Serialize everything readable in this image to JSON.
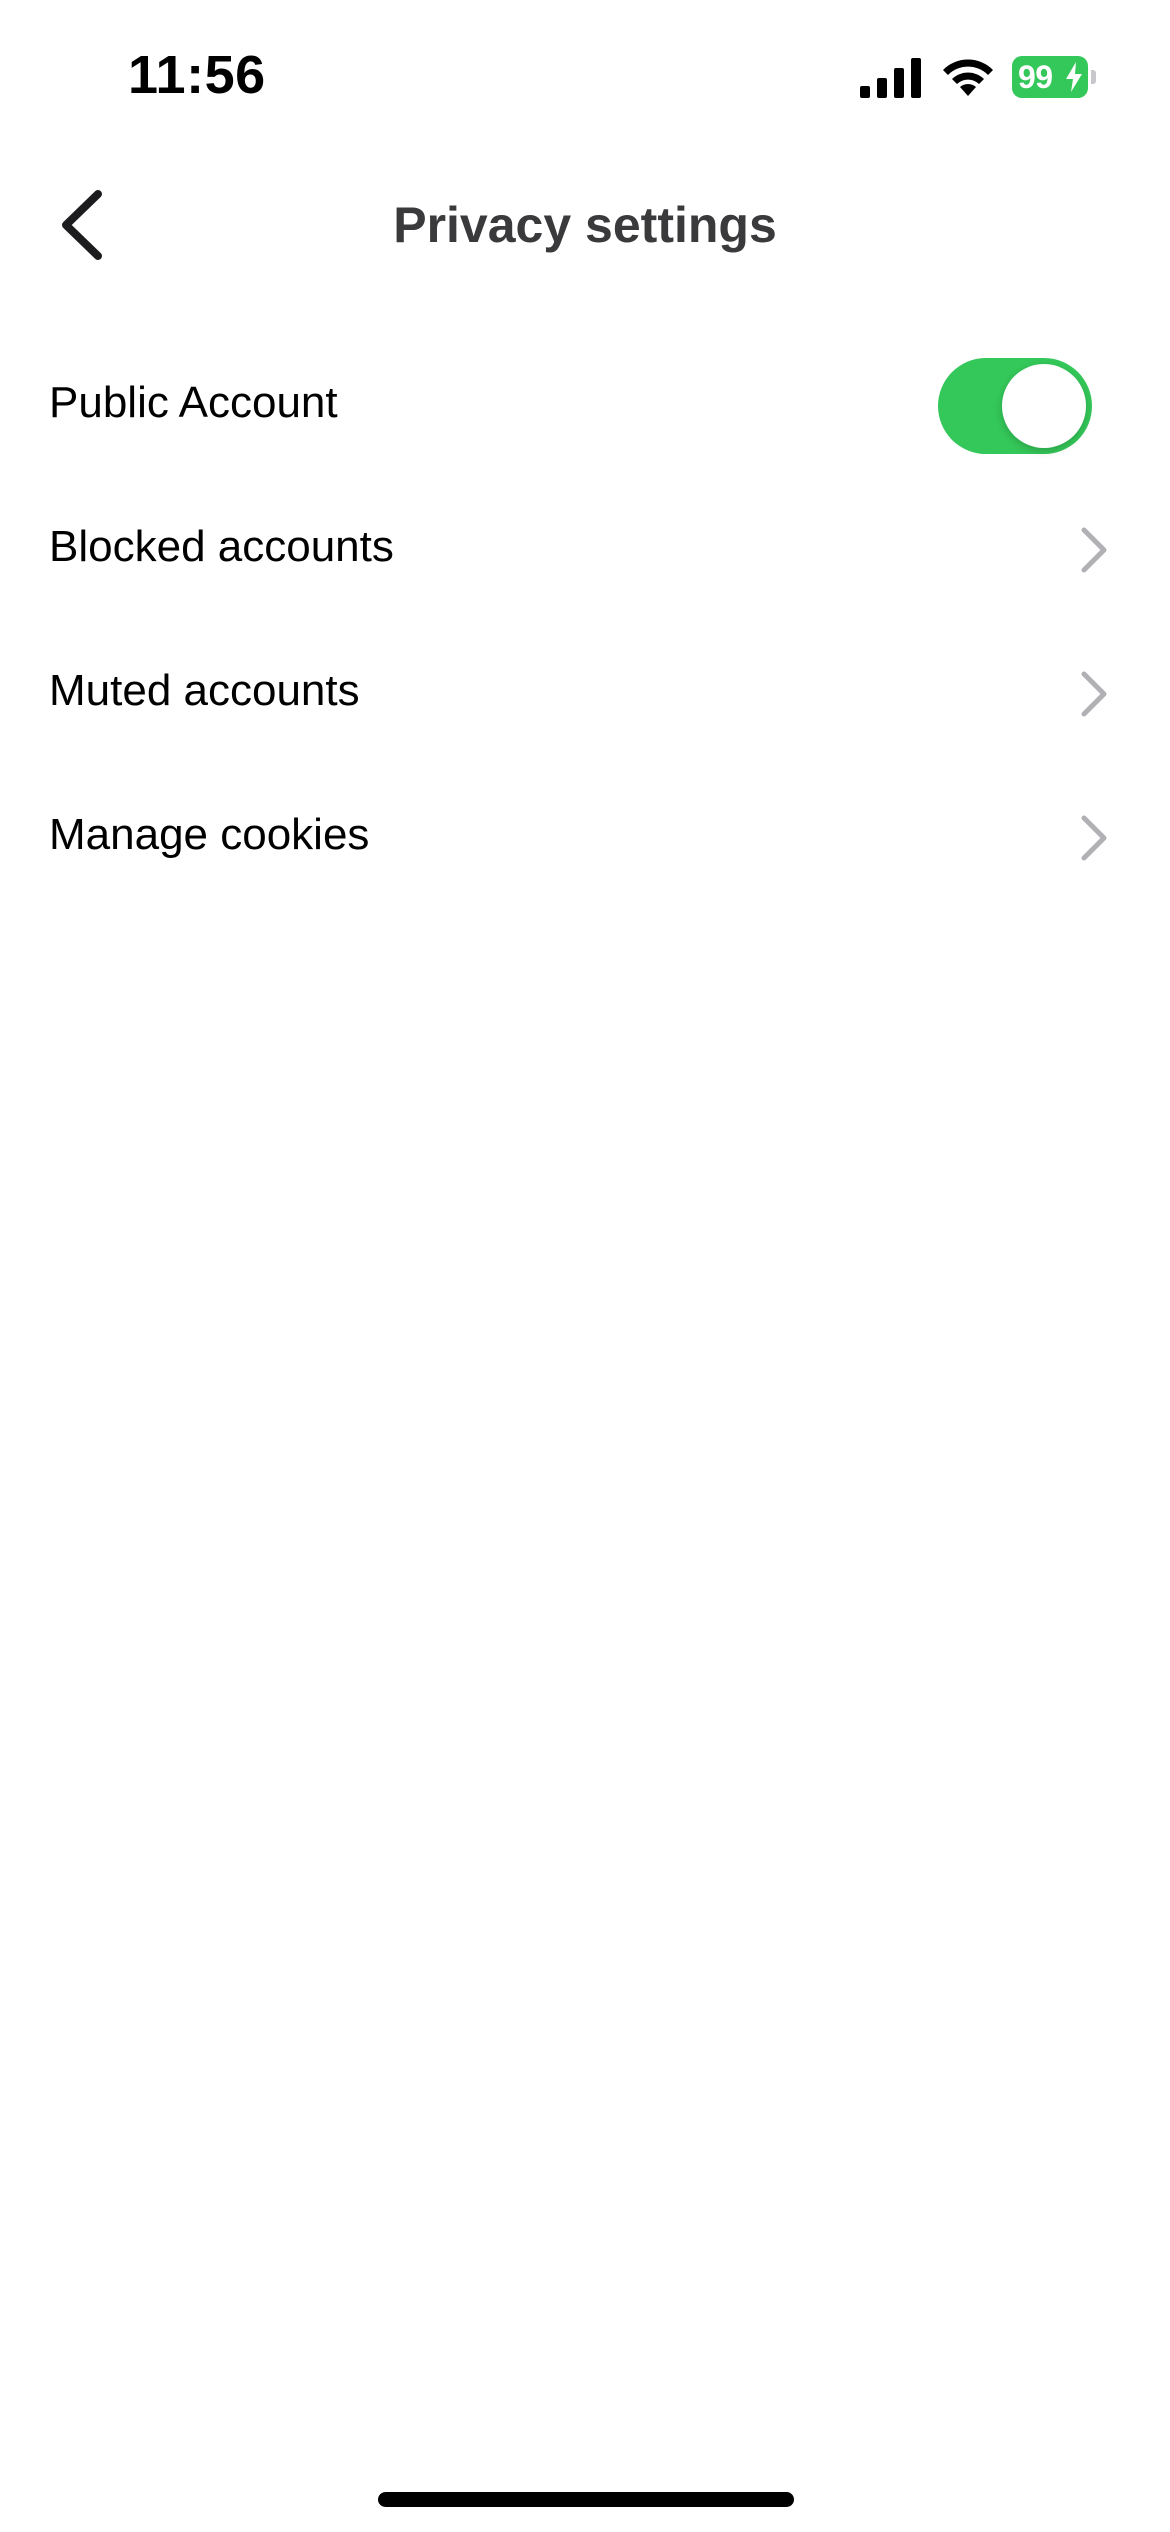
{
  "status_bar": {
    "time": "11:56",
    "battery_level": "99",
    "battery_charging": true,
    "battery_color": "#34c759"
  },
  "header": {
    "title": "Privacy settings",
    "back_icon": "chevron-left-icon"
  },
  "settings": {
    "public_account": {
      "label": "Public Account",
      "enabled": true,
      "toggle_color": "#34c759"
    },
    "items": [
      {
        "label": "Blocked accounts",
        "icon": "chevron-right-icon"
      },
      {
        "label": "Muted accounts",
        "icon": "chevron-right-icon"
      },
      {
        "label": "Manage cookies",
        "icon": "chevron-right-icon"
      }
    ]
  }
}
